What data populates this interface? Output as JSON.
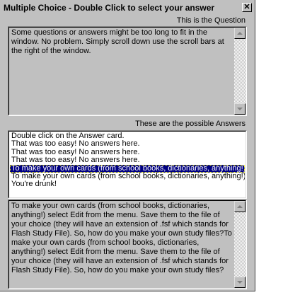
{
  "window": {
    "title": "Multiple Choice - Double Click to select your answer",
    "close_glyph": "✕"
  },
  "question": {
    "label": "This is the Question",
    "text": "Some questions or answers might be too long to fit in the window. No problem. Simply scroll down use the scroll bars at the right of the window."
  },
  "answers": {
    "label": "These are the possible Answers",
    "items": [
      "Double click on the Answer card.",
      "That was too easy! No answers here.",
      "That was too easy! No answers here.",
      "That was too easy! No answers here.",
      "To make your own cards (from school books, dictionaries, anything!) se",
      "To make your own cards (from school books, dictionaries, anything!) se",
      "You're drunk!"
    ],
    "selected_index": 4
  },
  "detail": {
    "text": "To make your own cards (from school books, dictionaries, anything!) select Edit from the menu. Save them to the file of your choice (they will have an extension of .fsf which stands for Flash Study File). So, how do you make your own study files?To make your own cards (from school books, dictionaries, anything!) select Edit from the menu. Save them to the file of your choice (they will have an extension of .fsf which stands for Flash Study File). So, how do you make your own study files?"
  },
  "colors": {
    "face": "#c0c0c0",
    "selection": "#000080",
    "selection_text": "#ffffff"
  },
  "icons": {
    "close": "close-icon",
    "scroll_up": "scroll-up-arrow-icon",
    "scroll_down": "scroll-down-arrow-icon"
  }
}
